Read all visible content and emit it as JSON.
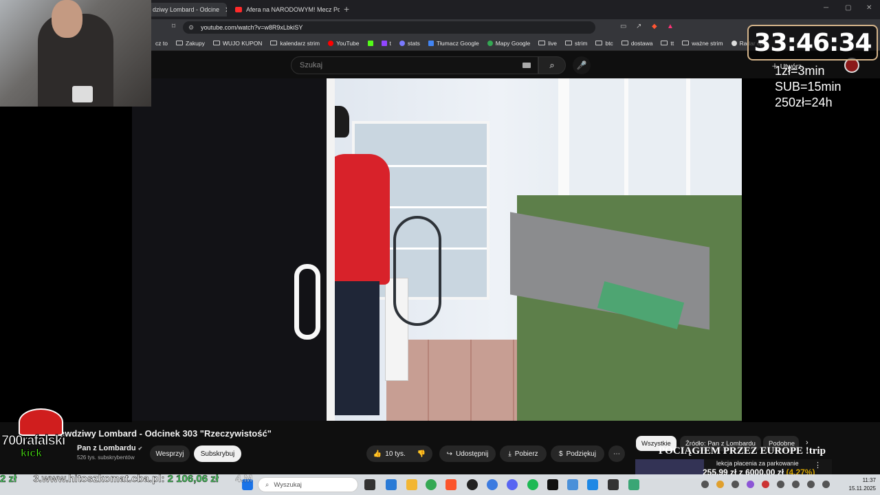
{
  "browser": {
    "tabs": [
      {
        "label": "dziwy Lombard - Odcine"
      },
      {
        "label": "Afera na NARODOWYM! Mecz Polsk"
      }
    ],
    "new_tab": "+",
    "url": "youtube.com/watch?v=w8R9xLbkiSY",
    "bookmarks": [
      "cz to",
      "Zakupy",
      "WUJO KUPON",
      "kalendarz strim",
      "YouTube",
      "t",
      "stats",
      "Tłumacz Google",
      "Mapy Google",
      "live",
      "strim",
      "btc",
      "dostawa",
      "tt",
      "ważne strim",
      "Radar opa"
    ]
  },
  "youtube": {
    "search_placeholder": "Szukaj",
    "create_label": "Utwórz",
    "video_title": "rawdziwy Lombard - Odcinek 303 \"Rzeczywistość\"",
    "channel_name": "Pan z Lombardu",
    "subscribers": "526 tys. subskrybentów",
    "support_label": "Wesprzyj",
    "subscribe_label": "Subskrybuj",
    "likes": "10 tys.",
    "share_label": "Udostępnij",
    "download_label": "Pobierz",
    "thanks_label": "Podziękuj",
    "chips": [
      "Wszystkie",
      "Źródło: Pan z Lombardu",
      "Podobne"
    ],
    "reco_title": "lekcja płacenia za parkowanie"
  },
  "stream_overlay": {
    "timer": "33:46:34",
    "rates": [
      "1zł=3min",
      "SUB=15min",
      "250zł=24h"
    ],
    "logo_name": "700rafalski",
    "logo_platform": "kick",
    "promo": "POCIĄGIEM PRZEZ EUROPE !trip",
    "goal_amount": "255,99 zł",
    "goal_of": "z",
    "goal_target": "6000,00 zł",
    "goal_pct": "(4,27%)",
    "ticker_prefix": "2 zł",
    "ticker_text": "3.www.hitoszkomat.cba.pl:",
    "ticker_amount": "2 106,06 zł",
    "ticker_suffix": "4.M"
  },
  "taskbar": {
    "search_placeholder": "Wyszukaj",
    "time": "11:37",
    "date": "15.11.2025"
  },
  "colors": {
    "yt_bg": "#0f0f0f",
    "kick_green": "#53fc18",
    "hoodie_red": "#d8222a",
    "goal_gold": "#d3a200"
  }
}
